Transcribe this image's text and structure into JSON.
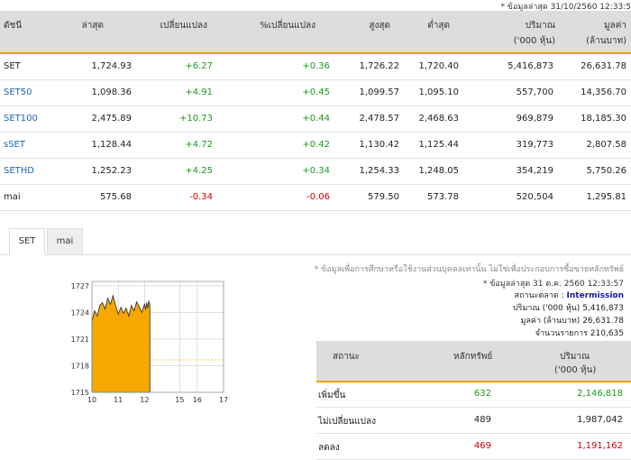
{
  "updated_text": "* ข้อมูลล่าสุด 31/10/2560 12:33:5",
  "market_table": {
    "headers": {
      "index": "ดัชนี",
      "last": "ล่าสุด",
      "change": "เปลี่ยนแปลง",
      "pct_change": "%เปลี่ยนแปลง",
      "high": "สูงสุด",
      "low": "ต่ำสุด",
      "volume": "ปริมาณ",
      "volume_unit": "('000 หุ้น)",
      "value": "มูลค่า",
      "value_unit": "(ล้านบาท)"
    },
    "rows": [
      {
        "name": "SET",
        "last": "1,724.93",
        "change": "+6.27",
        "pct": "+0.36",
        "high": "1,726.22",
        "low": "1,720.40",
        "volume": "5,416,873",
        "value": "26,631.78"
      },
      {
        "name": "SET50",
        "last": "1,098.36",
        "change": "+4.91",
        "pct": "+0.45",
        "high": "1,099.57",
        "low": "1,095.10",
        "volume": "557,700",
        "value": "14,356.70"
      },
      {
        "name": "SET100",
        "last": "2,475.89",
        "change": "+10.73",
        "pct": "+0.44",
        "high": "2,478.57",
        "low": "2,468.63",
        "volume": "969,879",
        "value": "18,185.30"
      },
      {
        "name": "sSET",
        "last": "1,128.44",
        "change": "+4.72",
        "pct": "+0.42",
        "high": "1,130.42",
        "low": "1,125.44",
        "volume": "319,773",
        "value": "2,807.58"
      },
      {
        "name": "SETHD",
        "last": "1,252.23",
        "change": "+4.25",
        "pct": "+0.34",
        "high": "1,254.33",
        "low": "1,248.05",
        "volume": "354,219",
        "value": "5,750.26"
      },
      {
        "name": "mai",
        "last": "575.68",
        "change": "-0.34",
        "pct": "-0.06",
        "high": "579.50",
        "low": "573.78",
        "volume": "520,504",
        "value": "1,295.81"
      }
    ]
  },
  "tabs": [
    {
      "label": "SET"
    },
    {
      "label": "mai"
    }
  ],
  "chart": {
    "y_ticks": [
      "1727",
      "1724",
      "1721",
      "1718",
      "1715"
    ],
    "x_ticks": [
      "10",
      "11",
      "12",
      "15",
      "16",
      "17"
    ],
    "colors": {
      "area": "#f5a800",
      "reference": "#f5a800",
      "grid": "#cccccc"
    }
  },
  "chart_data": {
    "type": "area",
    "title": "",
    "xlabel": "",
    "ylabel": "",
    "x_range": [
      10,
      17
    ],
    "ylim": [
      1715,
      1727.5
    ],
    "reference_line": 1718.66,
    "series": [
      {
        "x": [
          10.0,
          10.1,
          10.2,
          10.3,
          10.4,
          10.5,
          10.6,
          10.7,
          10.8,
          10.9,
          11.0,
          11.1,
          11.2,
          11.3,
          11.4,
          11.5,
          11.6,
          11.7,
          11.8,
          11.9,
          12.0,
          12.1,
          12.2,
          12.3,
          12.4,
          12.5
        ],
        "values": [
          1723.0,
          1724.2,
          1723.6,
          1724.8,
          1725.1,
          1724.4,
          1725.6,
          1724.9,
          1725.9,
          1724.8,
          1723.8,
          1724.6,
          1723.9,
          1724.5,
          1723.6,
          1724.8,
          1724.2,
          1725.2,
          1724.6,
          1724.0,
          1725.0,
          1724.3,
          1725.1,
          1724.5,
          1725.3,
          1724.93
        ]
      }
    ]
  },
  "disclaimer": "* ข้อมูลเพื่อการศึกษาหรือใช้งานส่วนบุคคลเท่านั้น ไม่ใช่เพื่อประกอบการซื้อขายหลักทรัพย์",
  "status": {
    "updated": "* ข้อมูลล่าสุด 31 ต.ค. 2560 12:33:57",
    "market_label": "สถานะตลาด :",
    "market_value": "Intermission",
    "volume_label": "ปริมาณ ('000 หุ้น)",
    "volume_value": "5,416,873",
    "value_label": "มูลค่า (ล้านบาท)",
    "value_value": "26,631.78",
    "deals_label": "จำนวนรายการ",
    "deals_value": "210,635"
  },
  "breadth_table": {
    "headers": {
      "status": "สถานะ",
      "securities": "หลักทรัพย์",
      "volume": "ปริมาณ",
      "volume_unit": "('000 หุ้น)"
    },
    "rows": [
      {
        "status": "เพิ่มขึ้น",
        "securities": "632",
        "volume": "2,146,818"
      },
      {
        "status": "ไม่เปลี่ยนแปลง",
        "securities": "489",
        "volume": "1,987,042"
      },
      {
        "status": "ลดลง",
        "securities": "469",
        "volume": "1,191,162"
      }
    ]
  }
}
